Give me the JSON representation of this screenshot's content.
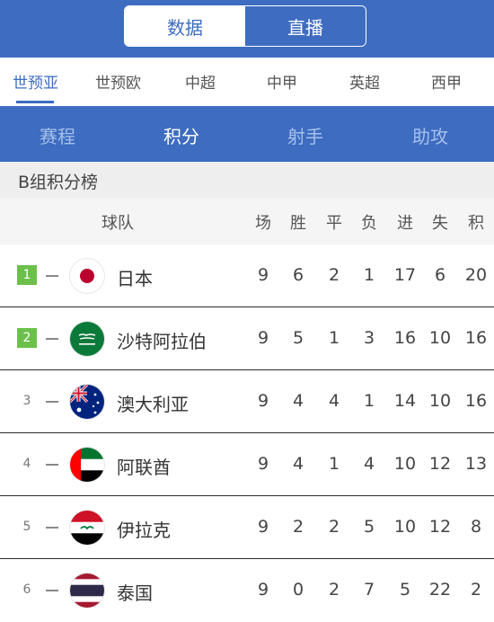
{
  "tabs": {
    "data_label": "数据",
    "live_label": "直播"
  },
  "leagues": [
    {
      "label": "世预亚",
      "active": true
    },
    {
      "label": "世预欧",
      "active": false
    },
    {
      "label": "中超",
      "active": false
    },
    {
      "label": "中甲",
      "active": false
    },
    {
      "label": "英超",
      "active": false
    },
    {
      "label": "西甲",
      "active": false
    }
  ],
  "subtabs": [
    {
      "label": "赛程",
      "active": false
    },
    {
      "label": "积分",
      "active": true
    },
    {
      "label": "射手",
      "active": false
    },
    {
      "label": "助攻",
      "active": false
    }
  ],
  "group_title": "B组积分榜",
  "columns": {
    "team": "球队",
    "played": "场",
    "won": "胜",
    "drawn": "平",
    "lost": "负",
    "gf": "进",
    "ga": "失",
    "pts": "积"
  },
  "colors": {
    "primary": "#3d6cc0",
    "qualify": "#6cc04a"
  },
  "rows": [
    {
      "rank": "1",
      "qualified": true,
      "trend": "—",
      "flag": "japan-flag-icon",
      "team": "日本",
      "played": "9",
      "won": "6",
      "drawn": "2",
      "lost": "1",
      "gf": "17",
      "ga": "6",
      "pts": "20"
    },
    {
      "rank": "2",
      "qualified": true,
      "trend": "—",
      "flag": "saudi-arabia-flag-icon",
      "team": "沙特阿拉伯",
      "played": "9",
      "won": "5",
      "drawn": "1",
      "lost": "3",
      "gf": "16",
      "ga": "10",
      "pts": "16"
    },
    {
      "rank": "3",
      "qualified": false,
      "trend": "—",
      "flag": "australia-flag-icon",
      "team": "澳大利亚",
      "played": "9",
      "won": "4",
      "drawn": "4",
      "lost": "1",
      "gf": "14",
      "ga": "10",
      "pts": "16"
    },
    {
      "rank": "4",
      "qualified": false,
      "trend": "—",
      "flag": "uae-flag-icon",
      "team": "阿联酋",
      "played": "9",
      "won": "4",
      "drawn": "1",
      "lost": "4",
      "gf": "10",
      "ga": "12",
      "pts": "13"
    },
    {
      "rank": "5",
      "qualified": false,
      "trend": "—",
      "flag": "iraq-flag-icon",
      "team": "伊拉克",
      "played": "9",
      "won": "2",
      "drawn": "2",
      "lost": "5",
      "gf": "10",
      "ga": "12",
      "pts": "8"
    },
    {
      "rank": "6",
      "qualified": false,
      "trend": "—",
      "flag": "thailand-flag-icon",
      "team": "泰国",
      "played": "9",
      "won": "0",
      "drawn": "2",
      "lost": "7",
      "gf": "5",
      "ga": "22",
      "pts": "2"
    }
  ]
}
